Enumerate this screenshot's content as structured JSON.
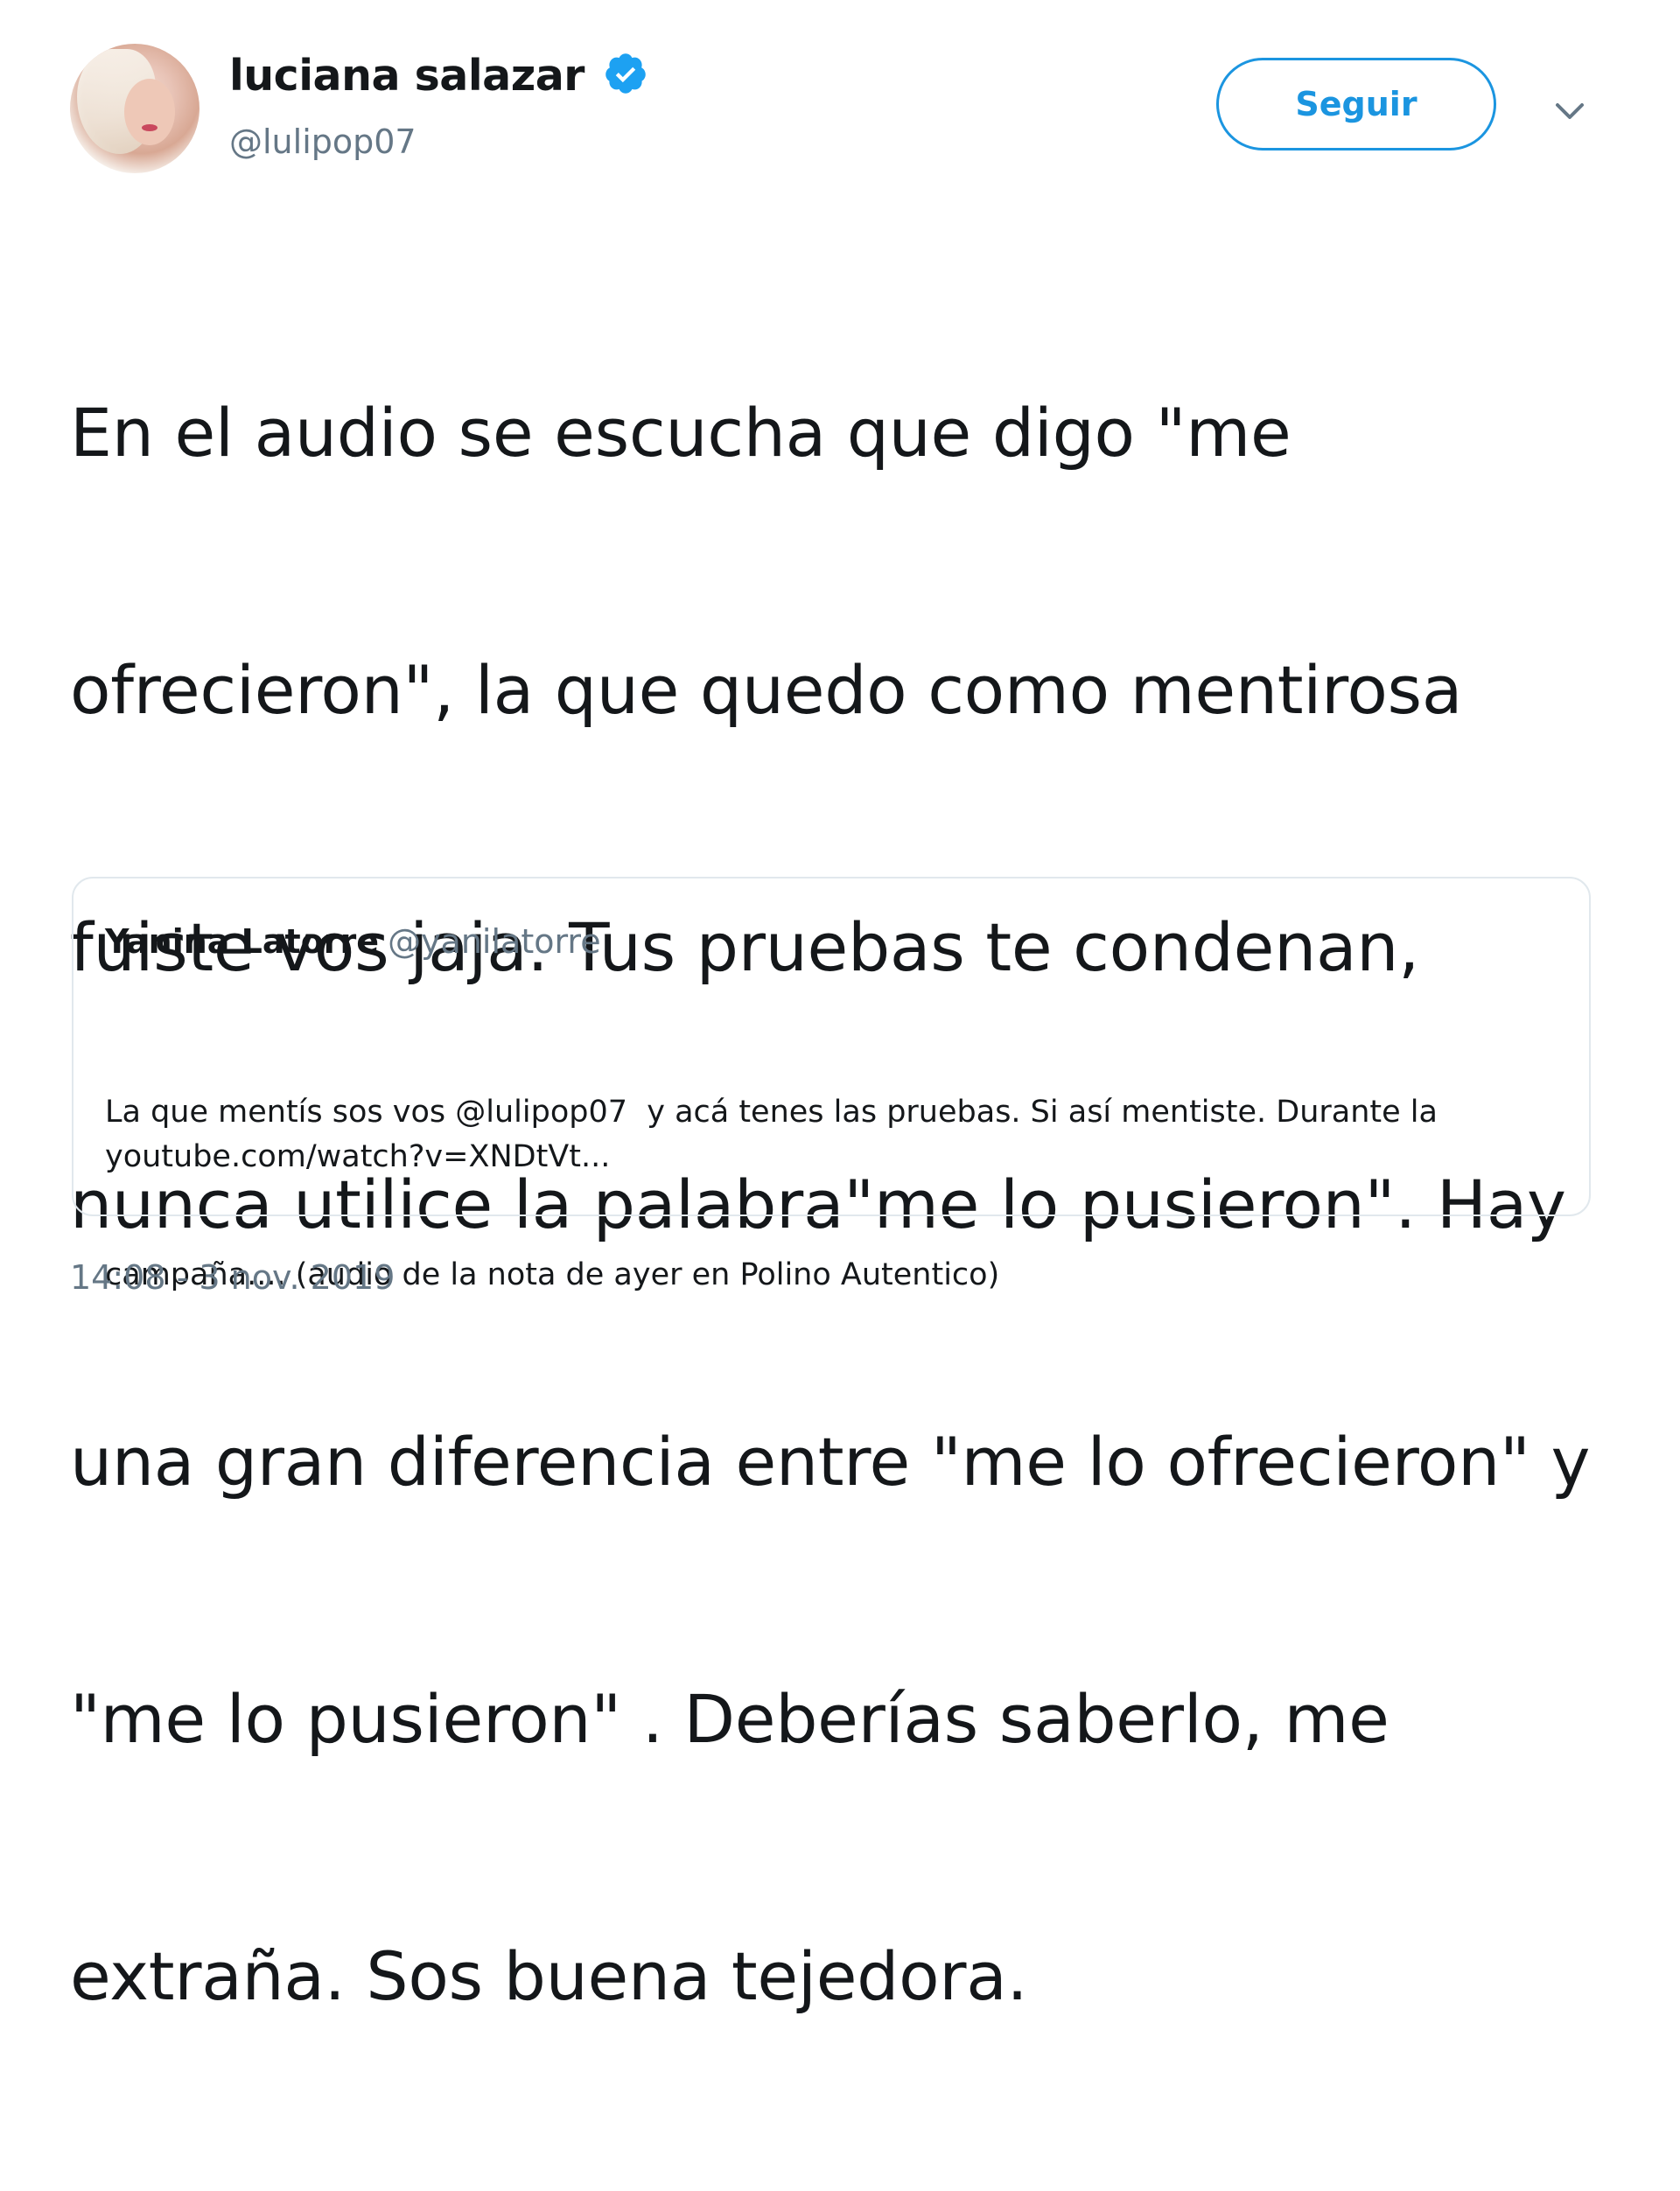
{
  "author": {
    "display_name": "luciana salazar",
    "handle": "@lulipop07",
    "verified": true,
    "avatar_icon": "profile-photo"
  },
  "actions": {
    "follow_label": "Seguir",
    "more_icon": "chevron-down-icon"
  },
  "tweet": {
    "text_lines": [
      "En el audio se escucha que digo \"me",
      "ofrecieron\", la que quedo como mentirosa",
      "fuiste vos jaja. Tus pruebas te condenan,",
      "nunca utilice la palabra\"me lo pusieron\". Hay",
      "una gran diferencia entre \"me lo ofrecieron\" y",
      "\"me lo pusieron\" . Deberías saberlo, me",
      "extraña. Sos buena tejedora."
    ],
    "timestamp": "14:08 - 3 nov. 2019"
  },
  "quoted_tweet": {
    "display_name": "Yanina Latorre",
    "handle": "@yanilatorre",
    "body_lines": [
      "La que mentís sos vos @lulipop07  y acá tenes las pruebas. Si así mentiste. Durante la",
      "campaña.... (audio de la nota de ayer en Polino Autentico)"
    ],
    "link": "youtube.com/watch?v=XNDtVt..."
  },
  "colors": {
    "accent": "#1b95e0",
    "text": "#14171a",
    "secondary_text": "#657786",
    "border": "#e1e8ed"
  }
}
